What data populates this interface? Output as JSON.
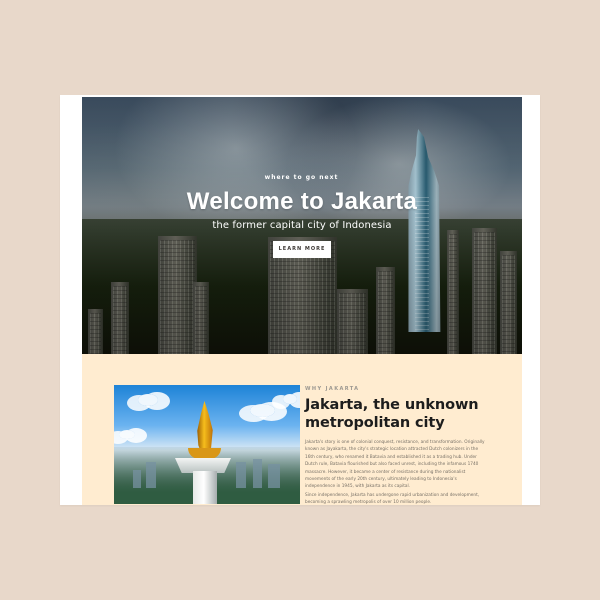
{
  "hero": {
    "eyebrow": "where to go next",
    "title": "Welcome to Jakarta",
    "subtitle": "the former capital city of Indonesia",
    "button_label": "LEARN MORE"
  },
  "about": {
    "section_label": "WHY JAKARTA",
    "title": "Jakarta, the unknown metropolitan city",
    "paragraphs": [
      "Jakarta's story is one of colonial conquest, resistance, and transformation. Originally known as Jayakarta, the city's strategic location attracted Dutch colonizers in the 16th century, who renamed it Batavia and established it as a trading hub. Under Dutch rule, Batavia flourished but also faced unrest, including the infamous 1740 massacre. However, it became a center of resistance during the nationalist movements of the early 20th century, ultimately leading to Indonesia's independence in 1945, with Jakarta as its capital.",
      "Since independence, Jakarta has undergone rapid urbanization and development, becoming a sprawling metropolis of over 10 million people."
    ]
  },
  "colors": {
    "page_background": "#e8d8ca",
    "content_background": "#ffecd0",
    "primary_text": "#1d1d1d",
    "button_background": "#ffffff"
  }
}
